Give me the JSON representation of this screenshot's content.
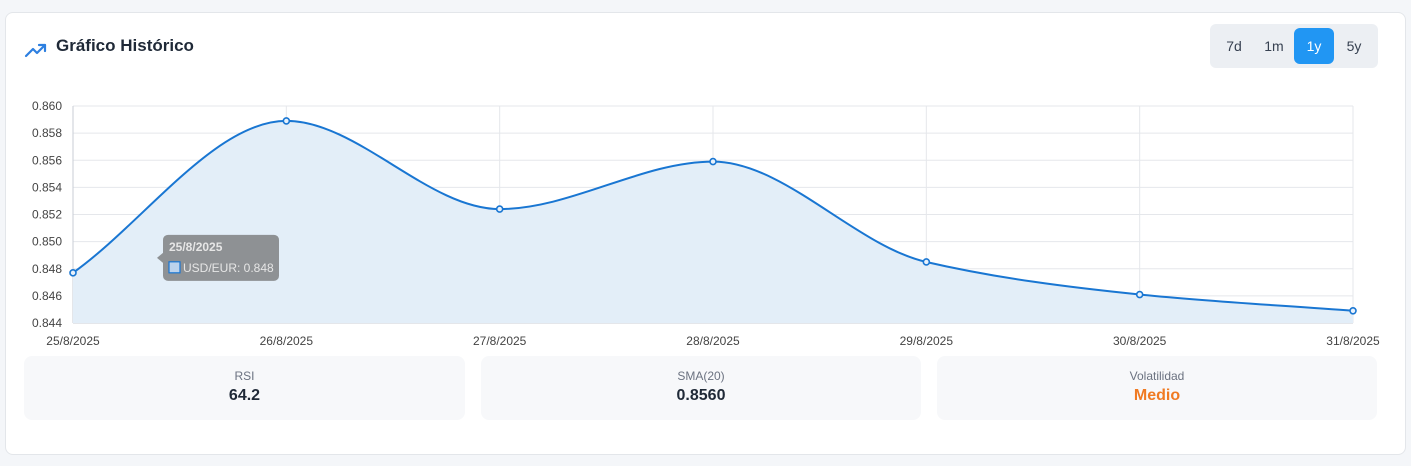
{
  "header": {
    "title": "Gráfico Histórico",
    "icon": "trending-up-icon",
    "icon_color": "#2d7fe0"
  },
  "ranges": [
    {
      "label": "7d",
      "active": false
    },
    {
      "label": "1m",
      "active": false
    },
    {
      "label": "1y",
      "active": true
    },
    {
      "label": "5y",
      "active": false
    }
  ],
  "chart_data": {
    "type": "area",
    "x": [
      "25/8/2025",
      "26/8/2025",
      "27/8/2025",
      "28/8/2025",
      "29/8/2025",
      "30/8/2025",
      "31/8/2025"
    ],
    "series": [
      {
        "name": "USD/EUR",
        "values": [
          0.8477,
          0.8589,
          0.8524,
          0.8559,
          0.8485,
          0.8461,
          0.8449
        ]
      }
    ],
    "ylim": [
      0.844,
      0.86
    ],
    "yticks": [
      "0.860",
      "0.858",
      "0.856",
      "0.854",
      "0.852",
      "0.850",
      "0.848",
      "0.846",
      "0.844"
    ],
    "grid": true,
    "line_color": "#1976d2",
    "fill_color": "#e3eef8",
    "tooltip": {
      "title": "25/8/2025",
      "label": "USD/EUR: 0.848"
    }
  },
  "stats": [
    {
      "label": "RSI",
      "value": "64.2",
      "color": "#1f2937"
    },
    {
      "label": "SMA(20)",
      "value": "0.8560",
      "color": "#1f2937"
    },
    {
      "label": "Volatilidad",
      "value": "Medio",
      "color": "#f07a22"
    }
  ]
}
